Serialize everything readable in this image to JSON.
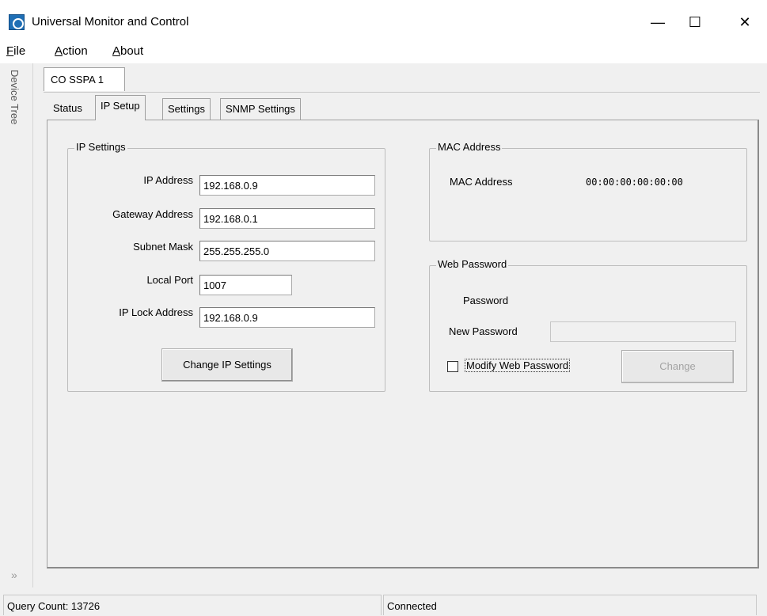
{
  "window": {
    "title": "Universal Monitor and Control",
    "controls": {
      "minimize": "—",
      "maximize": "☐",
      "close": "✕"
    }
  },
  "menu": [
    {
      "label": "File"
    },
    {
      "label": "Action"
    },
    {
      "label": "About"
    }
  ],
  "side_panel": {
    "label": "Device Tree",
    "chevron": "»"
  },
  "device_tab": {
    "label": "CO SSPA 1"
  },
  "tabs": [
    {
      "label": "Status",
      "active": false
    },
    {
      "label": "IP Setup",
      "active": true
    },
    {
      "label": "Settings",
      "active": false
    },
    {
      "label": "SNMP Settings",
      "active": false
    }
  ],
  "ip_settings": {
    "title": "IP Settings",
    "ip_address_label": "IP Address",
    "ip_address": "192.168.0.9",
    "gateway_label": "Gateway Address",
    "gateway": "192.168.0.1",
    "subnet_label": "Subnet Mask",
    "subnet": "255.255.255.0",
    "port_label": "Local Port",
    "port": "1007",
    "lock_label": "IP Lock Address",
    "lock": "192.168.0.9",
    "change_button": "Change IP Settings"
  },
  "mac": {
    "title": "MAC Address",
    "label": "MAC Address",
    "value": "00:00:00:00:00:00"
  },
  "web_password": {
    "title": "Web Password",
    "password_label": "Password",
    "new_password_label": "New Password",
    "new_password_value": "",
    "modify_checkbox_label": "Modify Web Password",
    "modify_checked": false,
    "change_button": "Change"
  },
  "status": {
    "query_count": "Query Count: 13726",
    "connection": "Connected"
  }
}
